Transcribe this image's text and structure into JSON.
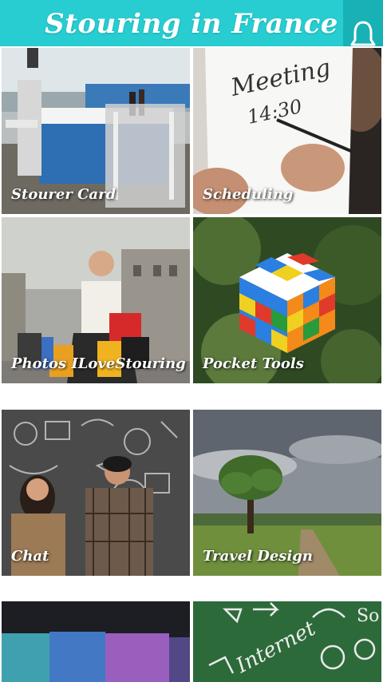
{
  "header": {
    "title": "Stouring in France",
    "bell_icon": "bell-icon"
  },
  "colors": {
    "header_bg": "#27cdd0",
    "bell_bg": "#18b1b6"
  },
  "tiles": [
    {
      "label": "Stourer Card"
    },
    {
      "label": "Scheduling"
    },
    {
      "label": "Photos ILoveStouring"
    },
    {
      "label": "Pocket Tools"
    },
    {
      "label": "Chat"
    },
    {
      "label": "Travel Design"
    },
    {
      "label": ""
    },
    {
      "label": ""
    }
  ],
  "notepad": {
    "line1": "Meeting",
    "line2": "14:30"
  },
  "board_words": {
    "word1": "Internet",
    "word2": "So"
  }
}
